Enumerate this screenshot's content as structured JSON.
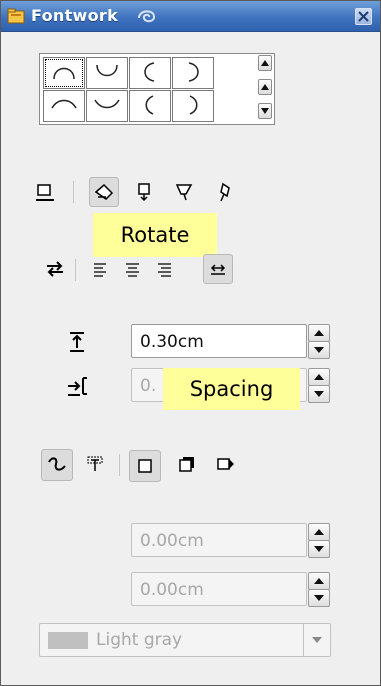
{
  "window": {
    "title": "Fontwork",
    "icons": {
      "app": "fontwork-app-icon",
      "anim": "swirl-icon",
      "close": "close-icon"
    }
  },
  "gallery": {
    "items": [
      "arc-up-icon",
      "arc-down-icon",
      "arc-left-icon",
      "arc-right-icon",
      "open-circle-up-icon",
      "open-circle-down-icon",
      "open-circle-left-icon",
      "open-circle-right-icon"
    ]
  },
  "toolbar1": {
    "icons": [
      "off-icon",
      "rotate-icon",
      "upright-icon",
      "slant-horizontal-icon",
      "slant-vertical-icon"
    ]
  },
  "tooltips": {
    "rotate": "Rotate",
    "spacing": "Spacing"
  },
  "toolbar2": {
    "icons": [
      "orientation-icon",
      "align-left-icon",
      "align-center-icon",
      "align-right-icon",
      "autosize-text-icon"
    ]
  },
  "distance": {
    "value": "0.30cm"
  },
  "indent": {
    "value": "0."
  },
  "toolbar3": {
    "icons": [
      "contour-icon",
      "text-frame-icon",
      "shadow-off-icon",
      "vertical-shadow-icon",
      "slant-shadow-icon"
    ]
  },
  "shadow_x": {
    "value": "0.00cm"
  },
  "shadow_y": {
    "value": "0.00cm"
  },
  "shadow_color": {
    "value": "Light gray",
    "swatch": "#c0c0c0"
  }
}
